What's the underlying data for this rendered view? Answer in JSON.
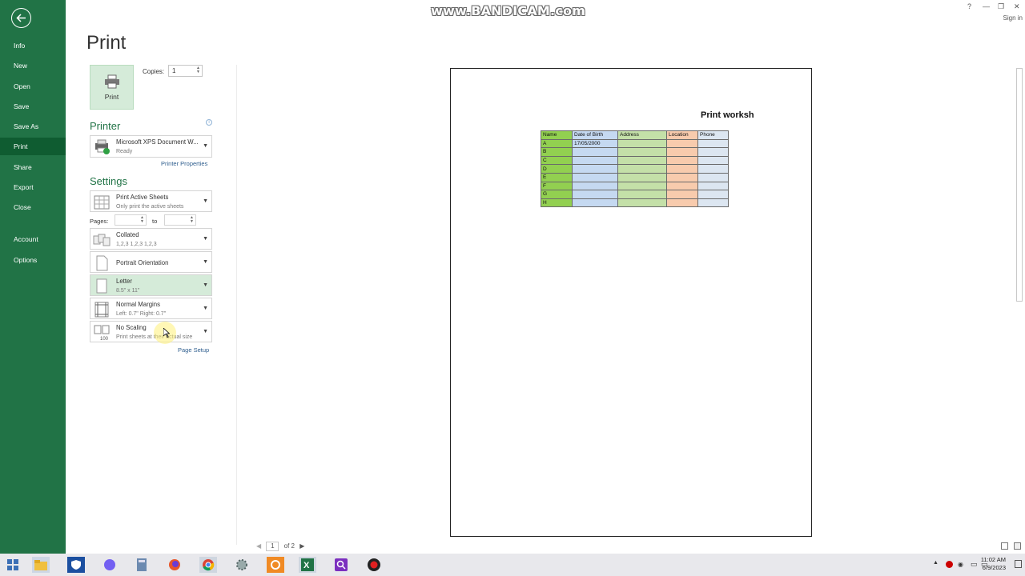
{
  "watermark": "www.BANDICAM.com",
  "window": {
    "help": "?",
    "minimize": "—",
    "restore": "❐",
    "close": "✕",
    "sign_in": "Sign in"
  },
  "nav": {
    "items": [
      {
        "label": "Info"
      },
      {
        "label": "New"
      },
      {
        "label": "Open"
      },
      {
        "label": "Save"
      },
      {
        "label": "Save As"
      },
      {
        "label": "Print"
      },
      {
        "label": "Share"
      },
      {
        "label": "Export"
      },
      {
        "label": "Close"
      },
      {
        "label": "Account"
      },
      {
        "label": "Options"
      }
    ],
    "active": "Print"
  },
  "page_title": "Print",
  "print_button": {
    "label": "Print"
  },
  "copies": {
    "label": "Copies:",
    "value": "1"
  },
  "printer": {
    "heading": "Printer",
    "name": "Microsoft XPS Document W...",
    "status": "Ready",
    "properties_link": "Printer Properties"
  },
  "settings": {
    "heading": "Settings",
    "active_sheets": {
      "title": "Print Active Sheets",
      "sub": "Only print the active sheets"
    },
    "pages": {
      "label": "Pages:",
      "to": "to",
      "from_value": "",
      "to_value": ""
    },
    "collated": {
      "title": "Collated",
      "sub": "1,2,3    1,2,3    1,2,3"
    },
    "orientation": {
      "title": "Portrait Orientation"
    },
    "paper": {
      "title": "Letter",
      "sub": "8.5\" x 11\""
    },
    "margins": {
      "title": "Normal Margins",
      "sub": "Left:  0.7\"    Right:  0.7\""
    },
    "scaling": {
      "title": "No Scaling",
      "sub": "Print sheets at their actual size"
    },
    "page_setup_link": "Page Setup"
  },
  "preview": {
    "title": "Print worksh",
    "headers": [
      "Name",
      "Date of Birth",
      "Address",
      "Location",
      "Phone"
    ],
    "rows": [
      [
        "A",
        "17/05/2000",
        "",
        "",
        ""
      ],
      [
        "B",
        "",
        "",
        "",
        ""
      ],
      [
        "C",
        "",
        "",
        "",
        ""
      ],
      [
        "D",
        "",
        "",
        "",
        ""
      ],
      [
        "E",
        "",
        "",
        "",
        ""
      ],
      [
        "F",
        "",
        "",
        "",
        ""
      ],
      [
        "G",
        "",
        "",
        "",
        ""
      ],
      [
        "H",
        "",
        "",
        "",
        ""
      ]
    ],
    "pager": {
      "current": "1",
      "of": "of 2"
    }
  },
  "taskbar": {
    "icons": [
      "windows-start-icon",
      "file-explorer-icon",
      "shield-app-icon",
      "viber-icon",
      "calculator-icon",
      "firefox-icon",
      "chrome-icon",
      "settings-app-icon",
      "orange-app-icon",
      "excel-icon",
      "search-app-icon",
      "record-icon"
    ],
    "time": "11:02 AM",
    "date": "6/9/2023"
  },
  "colors": {
    "accent": "#217346",
    "selected": "#d5ebd9"
  }
}
